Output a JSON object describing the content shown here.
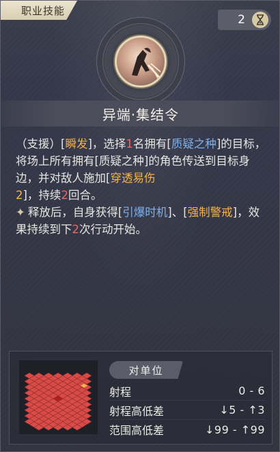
{
  "category_tab": "职业技能",
  "cost": {
    "value": "2",
    "icon": "hourglass-icon"
  },
  "skill_icon": "skill-portrait-icon",
  "skill_name": "异端·集结令",
  "description": {
    "p1": {
      "t1": "（支援）[",
      "k1": "瞬发",
      "t2": "]，选择",
      "n1": "1",
      "t3": "名拥有[",
      "k2": "质疑之种",
      "t4": "]的目标，将场上所有拥有[质疑之种]的角色传送到目标身边，并对敌人施加[",
      "k3": "穿透易伤",
      "n2": "2",
      "t5": "]，持续",
      "n3": "2",
      "t6": "回合。"
    },
    "p2": {
      "t1": "释放后，自身获得[",
      "k1": "引爆时机",
      "t2": "]、[",
      "k2": "强制警戒",
      "t3": "]，效果持续到下",
      "n1": "2",
      "t4": "次行动开始。"
    }
  },
  "stats": {
    "target_label": "对单位",
    "rows": [
      {
        "label": "射程",
        "value": "0 - 6"
      },
      {
        "label": "射程高低差",
        "value": "↓5 - ↑3"
      },
      {
        "label": "范围高低差",
        "value": "↓99 - ↑99"
      }
    ]
  },
  "colors": {
    "keyword_orange": "#f3b34c",
    "keyword_blue": "#7fb1e9",
    "number_red": "#f06561",
    "range_red": "#d94b48"
  }
}
